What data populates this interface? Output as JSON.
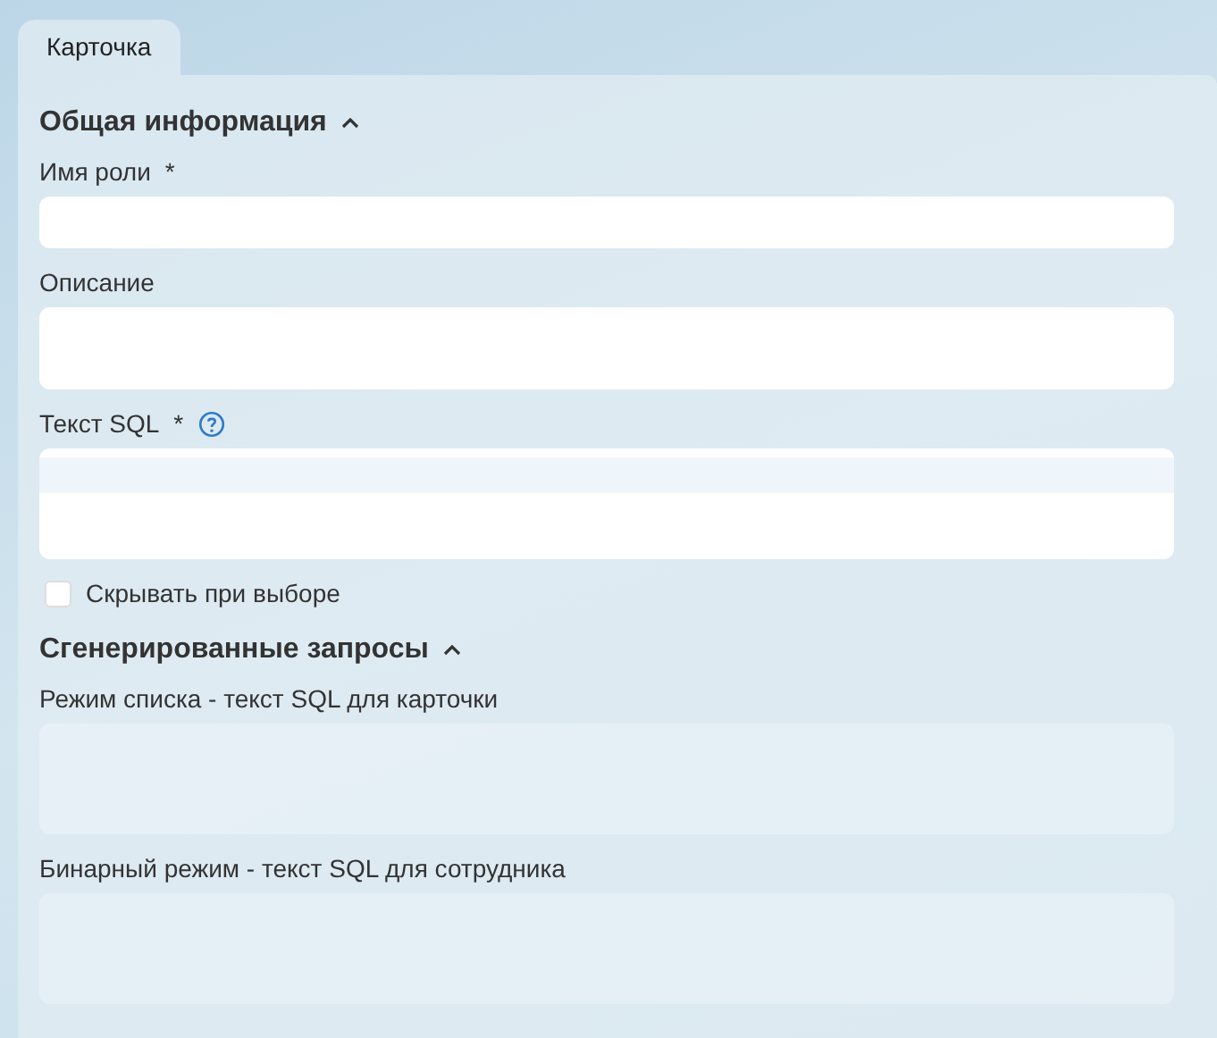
{
  "tabs": [
    {
      "label": "Карточка",
      "selected": true
    }
  ],
  "sections": [
    {
      "title": "Общая информация",
      "expanded": true,
      "items": [
        {
          "kind": "input",
          "label": "Имя роли",
          "required_mark": "*",
          "help": false,
          "disabled": false
        },
        {
          "kind": "textarea",
          "label": "Описание",
          "help": false,
          "disabled": false
        },
        {
          "kind": "code",
          "label": "Текст SQL",
          "required_mark": "*",
          "help": true,
          "disabled": false
        },
        {
          "kind": "checkbox",
          "label": "Скрывать при выборе",
          "checked": false
        }
      ]
    },
    {
      "title": "Сгенерированные запросы",
      "expanded": true,
      "items": [
        {
          "kind": "code",
          "label": "Режим списка - текст SQL для карточки",
          "help": false,
          "disabled": true
        },
        {
          "kind": "code",
          "label": "Бинарный режим - текст SQL для сотрудника",
          "help": false,
          "disabled": true
        }
      ]
    }
  ]
}
